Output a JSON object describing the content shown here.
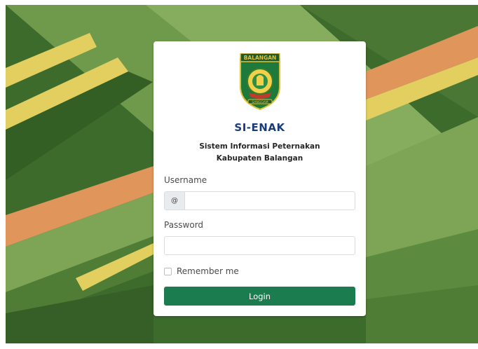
{
  "login_card": {
    "logo_text_top": "BALANGAN",
    "logo_text_bottom": "SANGGAM",
    "app_name": "SI-ENAK",
    "subtitle_line1": "Sistem Informasi Peternakan",
    "subtitle_line2": "Kabupaten Balangan",
    "username_label": "Username",
    "username_addon": "@",
    "username_value": "",
    "password_label": "Password",
    "password_value": "",
    "remember_label": "Remember me",
    "remember_checked": false,
    "login_label": "Login"
  },
  "colors": {
    "brand_green": "#1b7d4f",
    "title_blue": "#1b3c7a",
    "bg_dark_green": "#3d6b2c",
    "bg_light_green": "#7ea456",
    "bg_yellow": "#e2cf5f",
    "bg_orange": "#e0955a"
  }
}
